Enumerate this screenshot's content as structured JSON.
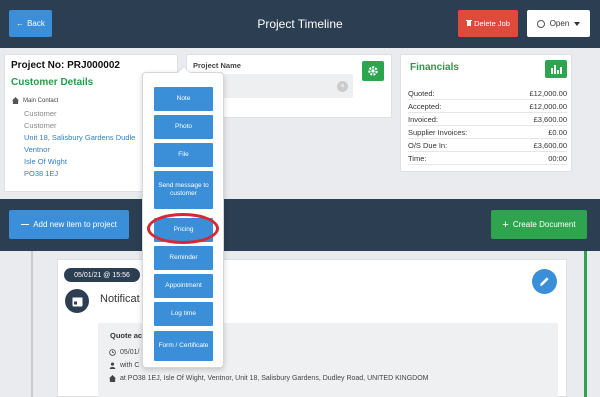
{
  "topbar": {
    "back_label": "Back",
    "title": "Project Timeline",
    "delete_label": "Delete Job",
    "status_label": "Open"
  },
  "project": {
    "number": "Project No: PRJ000002",
    "customer_heading": "Customer Details",
    "main_contact_label": "Main Contact",
    "lines": [
      "Customer",
      "Customer",
      "Unit 18, Salisbury Gardens Dudle",
      "Ventnor",
      "Isle Of Wight",
      "PO38 1EJ"
    ]
  },
  "project_name": {
    "label": "Project Name",
    "value": ""
  },
  "financials": {
    "title": "Financials",
    "rows": [
      {
        "label": "Quoted:",
        "value": "£12,000.00"
      },
      {
        "label": "Accepted:",
        "value": "£12,000.00"
      },
      {
        "label": "Invoiced:",
        "value": "£3,600.00"
      },
      {
        "label": "Supplier Invoices:",
        "value": "£0.00"
      },
      {
        "label": "O/S Due In:",
        "value": "£3,600.00"
      },
      {
        "label": "Time:",
        "value": "00:00"
      }
    ]
  },
  "actions": {
    "add_item_label": "Add new item to project",
    "create_doc_label": "Create Document"
  },
  "popup": {
    "items": [
      "Note",
      "Photo",
      "File",
      "Send message to customer",
      "Pricing",
      "Reminder",
      "Appointment",
      "Log time",
      "Form / Certificate"
    ]
  },
  "timeline": {
    "date": "05/01/21 @ 15:56",
    "title": "Notificat",
    "quote_title": "Quote ac",
    "date_line": "05/01/",
    "with_line": "with C",
    "address_line": "at PO38 1EJ, Isle Of Wight, Ventnor, Unit 18, Salisbury Gardens, Dudley Road, UNITED KINGDOM"
  },
  "colors": {
    "navy": "#2c3e52",
    "blue": "#3a8fd8",
    "green": "#2ea44f",
    "red": "#e04a3c",
    "highlight": "#d42a36"
  }
}
